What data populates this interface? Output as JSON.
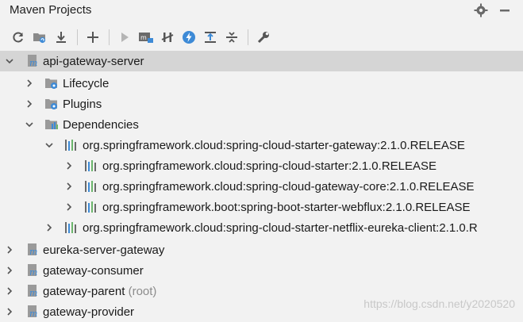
{
  "panel": {
    "title": "Maven Projects"
  },
  "tree": {
    "root": {
      "label": "api-gateway-server"
    },
    "lifecycle": {
      "label": "Lifecycle"
    },
    "plugins": {
      "label": "Plugins"
    },
    "dependencies": {
      "label": "Dependencies"
    },
    "dep_gateway": {
      "label": "org.springframework.cloud:spring-cloud-starter-gateway:2.1.0.RELEASE"
    },
    "dep_starter": {
      "label": "org.springframework.cloud:spring-cloud-starter:2.1.0.RELEASE"
    },
    "dep_gateway_core": {
      "label": "org.springframework.cloud:spring-cloud-gateway-core:2.1.0.RELEASE"
    },
    "dep_webflux": {
      "label": "org.springframework.boot:spring-boot-starter-webflux:2.1.0.RELEASE"
    },
    "dep_eureka": {
      "label": "org.springframework.cloud:spring-cloud-starter-netflix-eureka-client:2.1.0.R"
    },
    "proj_eureka": {
      "label": "eureka-server-gateway"
    },
    "proj_consumer": {
      "label": "gateway-consumer"
    },
    "proj_parent": {
      "label": "gateway-parent",
      "suffix": "(root)"
    },
    "proj_provider": {
      "label": "gateway-provider"
    }
  },
  "watermark": "https://blog.csdn.net/y2020520",
  "colors": {
    "accent": "#3d8ad6",
    "selection": "#d5d5d5",
    "background": "#f2f2f2"
  }
}
